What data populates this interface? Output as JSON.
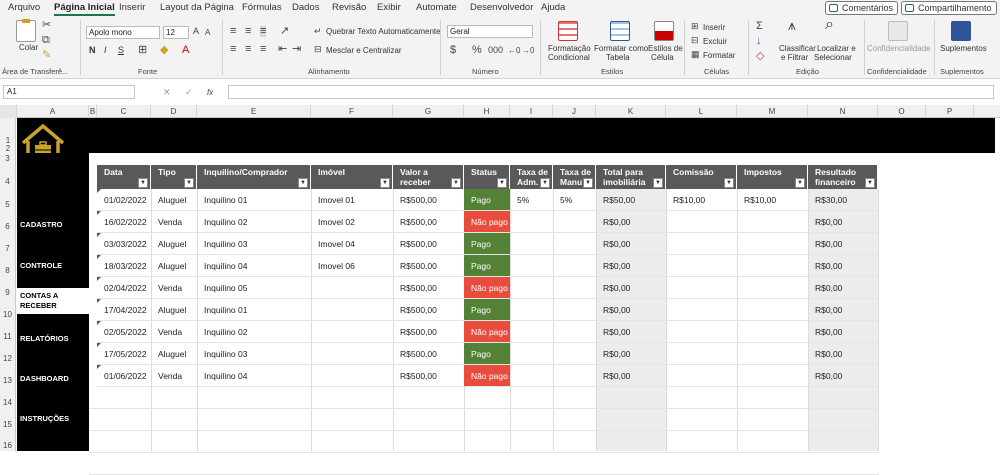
{
  "menu": {
    "items": [
      "Arquivo",
      "Página Inicial",
      "Inserir",
      "Layout da Página",
      "Fórmulas",
      "Dados",
      "Revisão",
      "Exibir",
      "Automate",
      "Desenvolvedor",
      "Ajuda"
    ],
    "active": "Página Inicial",
    "comments_label": "Comentários",
    "share_label": "Compartilhamento"
  },
  "ribbon": {
    "clipboard": {
      "paste_label": "Colar",
      "group_label": "Área de Transferê..."
    },
    "font": {
      "family": "Apolo mono",
      "size": "12",
      "group_label": "Fonte",
      "bold": "N",
      "italic": "I",
      "underline": "S"
    },
    "alignment": {
      "wrap_label": "Quebrar Texto Automaticamente",
      "merge_label": "Mesclar e Centralizar",
      "group_label": "Alinhamento"
    },
    "number": {
      "format": "Geral",
      "group_label": "Número"
    },
    "styles": {
      "conditional_label1": "Formatação",
      "conditional_label2": "Condicional",
      "table_label1": "Formatar como",
      "table_label2": "Tabela",
      "cell_label1": "Estilos de",
      "cell_label2": "Célula",
      "group_label": "Estilos"
    },
    "cells": {
      "insert_label": "Inserir",
      "delete_label": "Excluir",
      "format_label": "Formatar",
      "group_label": "Células"
    },
    "editing": {
      "sort_label1": "Classificar",
      "sort_label2": "e Filtrar",
      "find_label1": "Localizar e",
      "find_label2": "Selecionar",
      "group_label": "Edição"
    },
    "sensitivity": {
      "label": "Confidencialidade",
      "group_label": "Confidencialidade"
    },
    "addins": {
      "label": "Suplementos",
      "group_label": "Suplementos"
    }
  },
  "formula_bar": {
    "name_box": "A1",
    "fx": "fx",
    "formula": ""
  },
  "columns": [
    "A",
    "B",
    "C",
    "D",
    "E",
    "F",
    "G",
    "H",
    "I",
    "J",
    "K",
    "L",
    "M",
    "N",
    "O",
    "P"
  ],
  "rows": [
    "1",
    "2",
    "3",
    "4",
    "5",
    "6",
    "7",
    "8",
    "9",
    "10",
    "11",
    "12",
    "13",
    "14",
    "15",
    "16"
  ],
  "sidebar": [
    {
      "label": "CADASTRO",
      "active": false
    },
    {
      "label": "CONTROLE",
      "active": false
    },
    {
      "label": "CONTAS A RECEBER",
      "active": true
    },
    {
      "label": "RELATÓRIOS",
      "active": false
    },
    {
      "label": "DASHBOARD",
      "active": false
    },
    {
      "label": "INSTRUÇÕES",
      "active": false
    }
  ],
  "colors": {
    "header_bg": "#595959",
    "pago": "#538135",
    "nao_pago": "#e84c3d",
    "accent": "#217346",
    "logo": "#c9a227"
  },
  "table": {
    "headers": [
      "Data",
      "Tipo",
      "Inquilino/Comprador",
      "Imóvel",
      "Valor a receber",
      "Status",
      "Taxa de Adm.",
      "Taxa de Manu",
      "Total para imobiliária",
      "Comissão",
      "Impostos",
      "Resultado financeiro"
    ],
    "rows": [
      [
        "01/02/2022",
        "Aluguel",
        "Inquilino 01",
        "Imovel 01",
        "R$500,00",
        "Pago",
        "5%",
        "5%",
        "R$50,00",
        "R$10,00",
        "R$10,00",
        "R$30,00"
      ],
      [
        "16/02/2022",
        "Venda",
        "Inquilino 02",
        "Imovel 02",
        "R$500,00",
        "Não pago",
        "",
        "",
        "R$0,00",
        "",
        "",
        "R$0,00"
      ],
      [
        "03/03/2022",
        "Aluguel",
        "Inquilino 03",
        "Imovel 04",
        "R$500,00",
        "Pago",
        "",
        "",
        "R$0,00",
        "",
        "",
        "R$0,00"
      ],
      [
        "18/03/2022",
        "Aluguel",
        "Inquilino 04",
        "Imovel 06",
        "R$500,00",
        "Pago",
        "",
        "",
        "R$0,00",
        "",
        "",
        "R$0,00"
      ],
      [
        "02/04/2022",
        "Venda",
        "Inquilino 05",
        "",
        "R$500,00",
        "Não pago",
        "",
        "",
        "R$0,00",
        "",
        "",
        "R$0,00"
      ],
      [
        "17/04/2022",
        "Aluguel",
        "Inquilino 01",
        "",
        "R$500,00",
        "Pago",
        "",
        "",
        "R$0,00",
        "",
        "",
        "R$0,00"
      ],
      [
        "02/05/2022",
        "Venda",
        "Inquilino 02",
        "",
        "R$500,00",
        "Não pago",
        "",
        "",
        "R$0,00",
        "",
        "",
        "R$0,00"
      ],
      [
        "17/05/2022",
        "Aluguel",
        "Inquilino 03",
        "",
        "R$500,00",
        "Pago",
        "",
        "",
        "R$0,00",
        "",
        "",
        "R$0,00"
      ],
      [
        "01/06/2022",
        "Venda",
        "Inquilino 04",
        "",
        "R$500,00",
        "Não pago",
        "",
        "",
        "R$0,00",
        "",
        "",
        "R$0,00"
      ]
    ]
  }
}
